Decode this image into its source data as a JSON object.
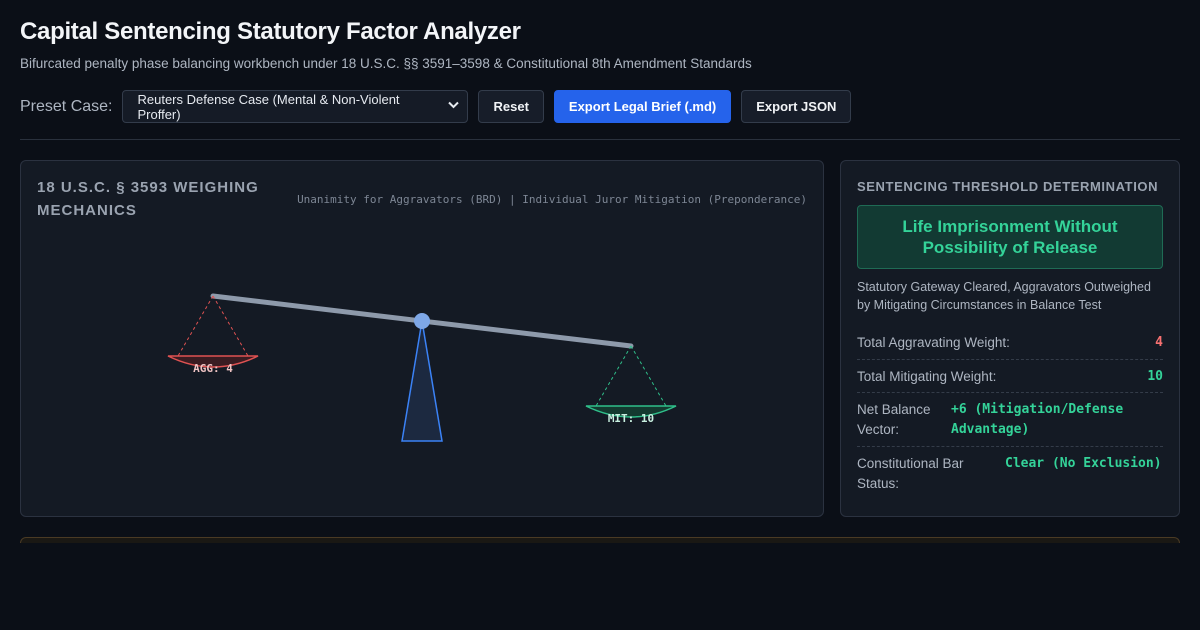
{
  "header": {
    "title": "Capital Sentencing Statutory Factor Analyzer",
    "subtitle": "Bifurcated penalty phase balancing workbench under 18 U.S.C. §§ 3591–3598 & Constitutional 8th Amendment Standards"
  },
  "toolbar": {
    "preset_label": "Preset Case:",
    "preset_selected": "Reuters Defense Case (Mental & Non-Violent Proffer)",
    "reset_label": "Reset",
    "export_brief_label": "Export Legal Brief (.md)",
    "export_json_label": "Export JSON"
  },
  "scale_panel": {
    "title": "18 U.S.C. § 3593 WEIGHING MECHANICS",
    "note": "Unanimity for Aggravators (BRD) | Individual Juror Mitigation (Preponderance)",
    "aggravating_label": "AGG: 4",
    "mitigating_label": "MIT: 10",
    "aggravating_weight": 4,
    "mitigating_weight": 10,
    "colors": {
      "aggravating": "#e05252",
      "mitigating": "#2fbf8a",
      "fulcrum": "#3b82f6",
      "beam": "#8e9aab"
    }
  },
  "result_panel": {
    "heading": "SENTENCING THRESHOLD DETERMINATION",
    "verdict": "Life Imprisonment Without Possibility of Release",
    "description": "Statutory Gateway Cleared, Aggravators Outweighed by Mitigating Circumstances in Balance Test",
    "metrics": [
      {
        "label": "Total Aggravating Weight:",
        "value": "4",
        "color": "#f87171"
      },
      {
        "label": "Total Mitigating Weight:",
        "value": "10",
        "color": "#34d399"
      },
      {
        "label": "Net Balance Vector:",
        "value": "+6 (Mitigation/Defense Advantage)",
        "color": "#34d399"
      },
      {
        "label": "Constitutional Bar Status:",
        "value": "Clear (No Exclusion)",
        "color": "#34d399"
      }
    ]
  }
}
